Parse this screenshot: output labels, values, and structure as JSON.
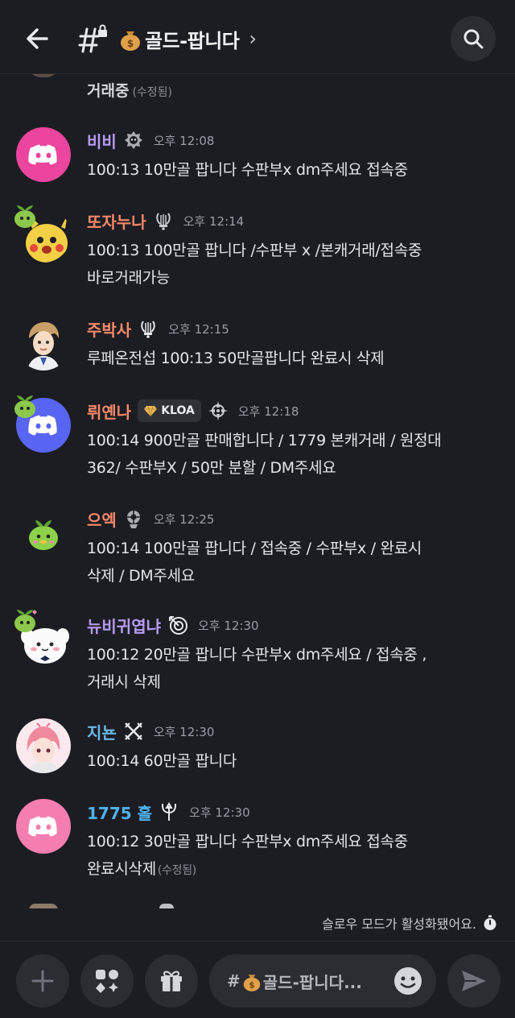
{
  "header": {
    "channel_name": "골드-팝니다",
    "chevron": "›",
    "icons": [
      "back-arrow-icon",
      "hash-lock-icon",
      "money-bag-icon",
      "search-icon"
    ]
  },
  "top_partial": {
    "text": "거래중",
    "edited": "(수정됨)"
  },
  "messages": [
    {
      "user": "비비",
      "color": "#b79cf7",
      "time": "오후 12:08",
      "lines": [
        "100:13 10만골 팝니다 수판부x dm주세요 접속중"
      ],
      "edited": ""
    },
    {
      "user": "또자누나",
      "color": "#f7896a",
      "time": "오후 12:14",
      "lines": [
        "100:13 100만골 팝니다 /수판부 x /본캐거래/접속중",
        "바로거래가능"
      ],
      "edited": ""
    },
    {
      "user": "주박사",
      "color": "#f7896a",
      "time": "오후 12:15",
      "lines": [
        "루페온전섭 100:13 50만골팝니다 완료시 삭제"
      ],
      "edited": ""
    },
    {
      "user": "뤼옌나",
      "color": "#f7896a",
      "tag": "KLOA",
      "time": "오후 12:18",
      "lines": [
        "100:14 900만골 판매합니다 / 1779 본캐거래 / 원정대",
        "362/ 수판부X / 50만 분할 / DM주세요"
      ],
      "edited": ""
    },
    {
      "user": "으엑",
      "color": "#f7896a",
      "time": "오후 12:25",
      "lines": [
        "100:14 100만골 팝니다 / 접속중 / 수판부x / 완료시",
        "삭제 / DM주세요"
      ],
      "edited": ""
    },
    {
      "user": "뉴비귀엽냐",
      "color": "#b79cf7",
      "time": "오후 12:30",
      "lines": [
        "100:12 20만골 팝니다 수판부x dm주세요 / 접속중 ,",
        "거래시 삭제"
      ],
      "edited": ""
    },
    {
      "user": "지뇬",
      "color": "#6ab7e8",
      "time": "오후 12:30",
      "lines": [
        "100:14 60만골 팝니다"
      ],
      "edited": ""
    },
    {
      "user": "1775 홀",
      "color": "#4fb3ee",
      "time": "오후 12:30",
      "lines": [
        "100:12 30만골 팝니다 수판부x dm주세요 접속중",
        "완료시삭제"
      ],
      "edited": "(수정됨)"
    }
  ],
  "slow_mode": {
    "text": "슬로우 모드가 활성화됐어요.",
    "icon": "stopwatch-icon"
  },
  "composer": {
    "placeholder_prefix": "#",
    "placeholder": "골드-팝니다...",
    "icons": [
      "plus-icon",
      "apps-icon",
      "gift-icon",
      "emoji-icon",
      "send-icon"
    ]
  }
}
